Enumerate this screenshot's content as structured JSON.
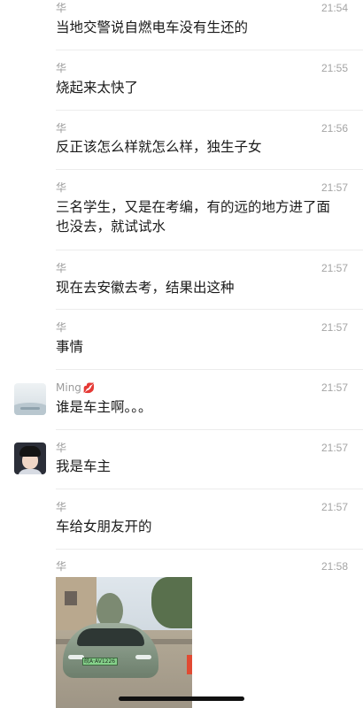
{
  "messages": [
    {
      "sender": "华",
      "time": "21:54",
      "text": "当地交警说自燃电车没有生还的"
    },
    {
      "sender": "华",
      "time": "21:55",
      "text": "烧起来太快了"
    },
    {
      "sender": "华",
      "time": "21:56",
      "text": "反正该怎么样就怎么样，独生子女"
    },
    {
      "sender": "华",
      "time": "21:57",
      "text": "三名学生，又是在考编，有的远的地方进了面\n也没去，就试试水"
    },
    {
      "sender": "华",
      "time": "21:57",
      "text": "现在去安徽去考，结果出这种"
    },
    {
      "sender": "华",
      "time": "21:57",
      "text": "事情"
    },
    {
      "sender": "Ming",
      "sender_emoji": "💋",
      "time": "21:57",
      "text": "谁是车主啊。。。"
    },
    {
      "sender": "华",
      "time": "21:57",
      "text": "我是车主"
    },
    {
      "sender": "华",
      "time": "21:57",
      "text": "车给女朋友开的"
    },
    {
      "sender": "华",
      "time": "21:58",
      "image": "photo of a green car",
      "plate": "皖A·AV1226"
    }
  ]
}
